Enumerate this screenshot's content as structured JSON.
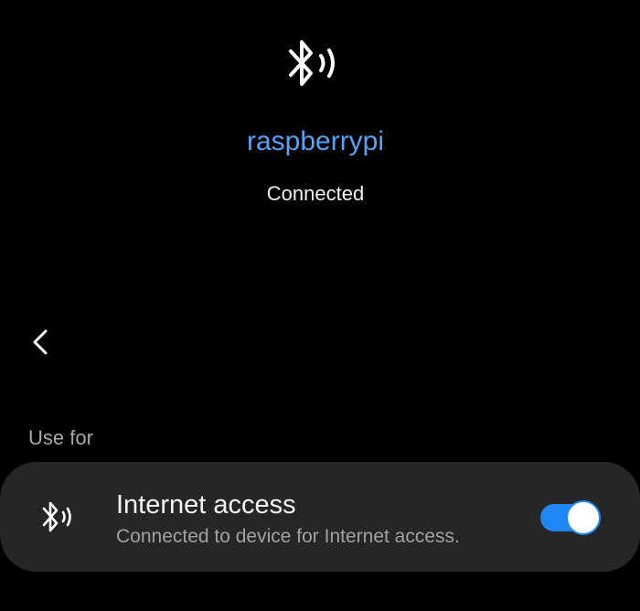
{
  "header": {
    "icon": "bluetooth-audio-icon",
    "device_name": "raspberrypi",
    "status": "Connected"
  },
  "navigation": {
    "back_icon": "chevron-left-icon"
  },
  "use_for": {
    "section_label": "Use for",
    "items": [
      {
        "icon": "bluetooth-audio-icon",
        "title": "Internet access",
        "subtitle": "Connected to device for Internet access.",
        "toggle_on": true
      }
    ]
  },
  "colors": {
    "background": "#000000",
    "accent": "#1e86f5",
    "device_name": "#5aa0f5",
    "card": "#262626"
  }
}
